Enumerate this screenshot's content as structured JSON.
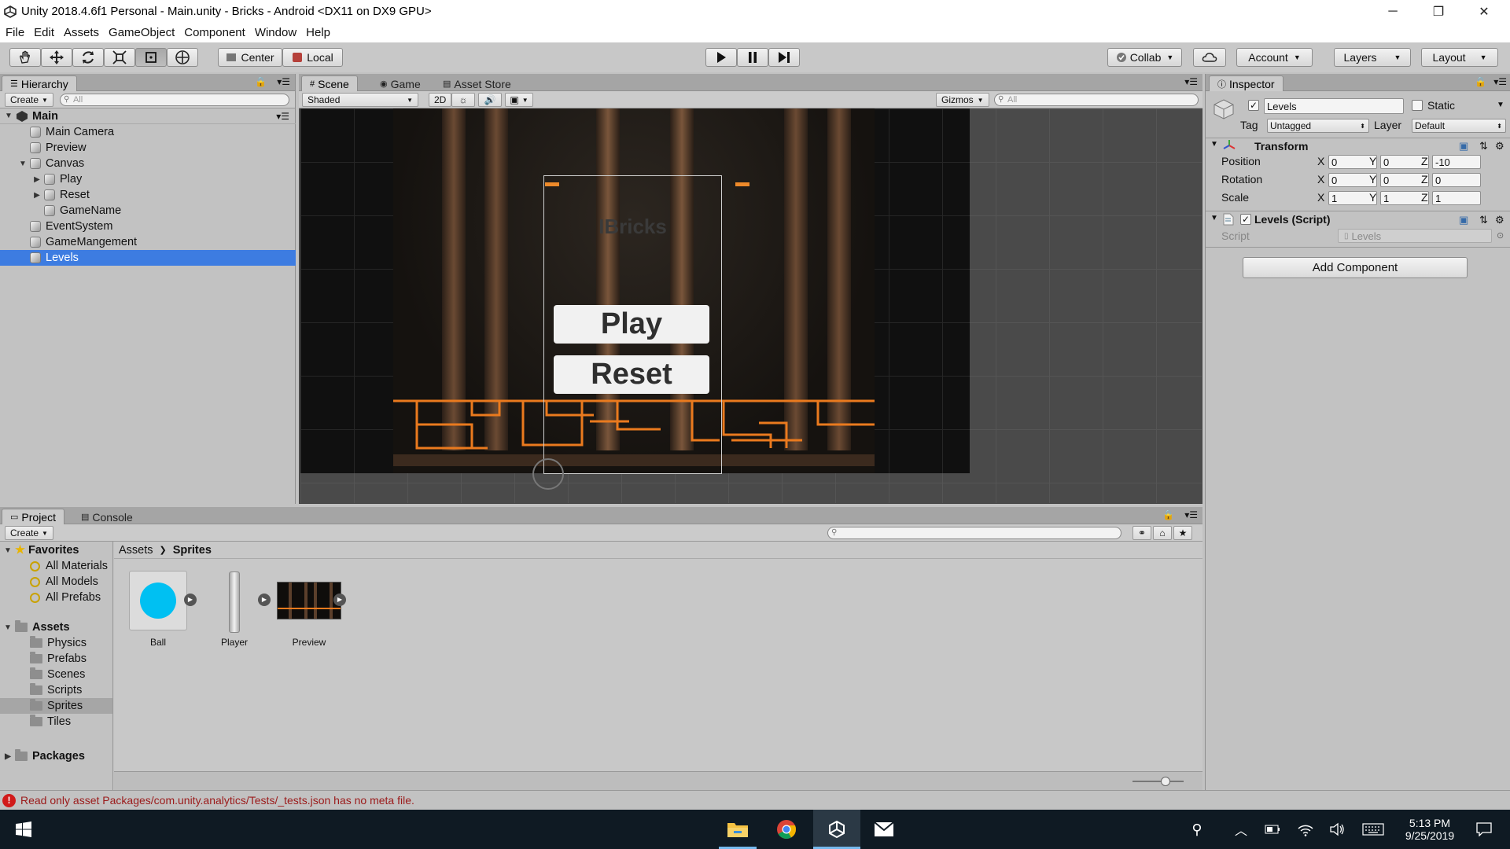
{
  "window": {
    "title": "Unity 2018.4.6f1 Personal - Main.unity - Bricks - Android <DX11 on DX9 GPU>",
    "controls": [
      "─",
      "❐",
      "✕"
    ]
  },
  "menu": [
    "File",
    "Edit",
    "Assets",
    "GameObject",
    "Component",
    "Window",
    "Help"
  ],
  "toolbar": {
    "tools": [
      "hand-tool",
      "move-tool",
      "rotate-tool",
      "scale-tool",
      "rect-tool",
      "transform-tool"
    ],
    "pivot": "Center",
    "space": "Local",
    "collab": "Collab",
    "account": "Account",
    "layers": "Layers",
    "layout": "Layout"
  },
  "hierarchy": {
    "tab": "Hierarchy",
    "create": "Create",
    "search_placeholder": "All",
    "scene": "Main",
    "items": [
      {
        "label": "Main Camera",
        "depth": 1,
        "expand": ""
      },
      {
        "label": "Preview",
        "depth": 1,
        "expand": ""
      },
      {
        "label": "Canvas",
        "depth": 1,
        "expand": "▼"
      },
      {
        "label": "Play",
        "depth": 2,
        "expand": "▶"
      },
      {
        "label": "Reset",
        "depth": 2,
        "expand": "▶"
      },
      {
        "label": "GameName",
        "depth": 2,
        "expand": ""
      },
      {
        "label": "EventSystem",
        "depth": 1,
        "expand": ""
      },
      {
        "label": "GameMangement",
        "depth": 1,
        "expand": ""
      },
      {
        "label": "Levels",
        "depth": 1,
        "expand": "",
        "selected": true
      }
    ]
  },
  "scene": {
    "tabs": [
      "Scene",
      "Game",
      "Asset Store"
    ],
    "shading": "Shaded",
    "mode_2d": "2D",
    "gizmos": "Gizmos",
    "search_placeholder": "All",
    "game_title": "IBricks",
    "play_label": "Play",
    "reset_label": "Reset"
  },
  "inspector": {
    "tab": "Inspector",
    "object_name": "Levels",
    "static_label": "Static",
    "tag_label": "Tag",
    "tag_value": "Untagged",
    "layer_label": "Layer",
    "layer_value": "Default",
    "transform": {
      "title": "Transform",
      "position": {
        "label": "Position",
        "x": "0",
        "y": "0",
        "z": "-10"
      },
      "rotation": {
        "label": "Rotation",
        "x": "0",
        "y": "0",
        "z": "0"
      },
      "scale": {
        "label": "Scale",
        "x": "1",
        "y": "1",
        "z": "1"
      }
    },
    "script": {
      "title": "Levels (Script)",
      "label": "Script",
      "value": "Levels"
    },
    "add_component": "Add Component"
  },
  "project": {
    "tabs": [
      "Project",
      "Console"
    ],
    "create": "Create",
    "favorites_title": "Favorites",
    "favorites": [
      "All Materials",
      "All Models",
      "All Prefabs"
    ],
    "assets_title": "Assets",
    "folders": [
      "Physics",
      "Prefabs",
      "Scenes",
      "Scripts",
      "Sprites",
      "Tiles"
    ],
    "selected_folder": "Sprites",
    "packages_title": "Packages",
    "breadcrumb": [
      "Assets",
      "Sprites"
    ],
    "assets": [
      {
        "name": "Ball",
        "icon": "circle-sprite",
        "color": "#00c0f2"
      },
      {
        "name": "Player",
        "icon": "paddle-sprite"
      },
      {
        "name": "Preview",
        "icon": "scene-preview-sprite"
      }
    ]
  },
  "status": {
    "message": "Read only asset Packages/com.unity.analytics/Tests/_tests.json has no meta file."
  },
  "taskbar": {
    "time": "5:13 PM",
    "date": "9/25/2019"
  },
  "colors": {
    "selection": "#3d7ce1",
    "bricks": "#ea7a1e",
    "ball": "#00c0f2",
    "error": "#d11a1a"
  }
}
